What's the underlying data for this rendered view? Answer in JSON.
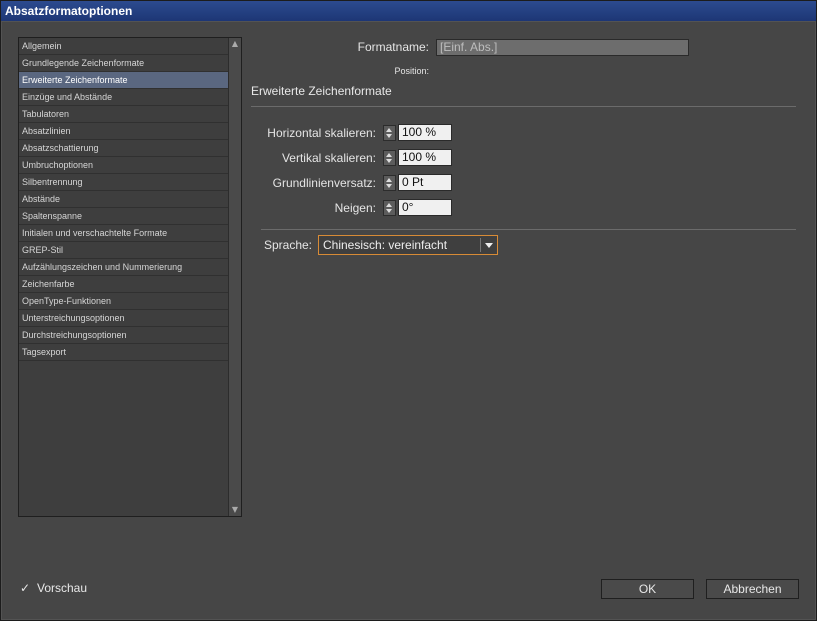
{
  "window": {
    "title": "Absatzformatoptionen"
  },
  "sidebar": {
    "items": [
      {
        "label": "Allgemein"
      },
      {
        "label": "Grundlegende Zeichenformate"
      },
      {
        "label": "Erweiterte Zeichenformate"
      },
      {
        "label": "Einzüge und Abstände"
      },
      {
        "label": "Tabulatoren"
      },
      {
        "label": "Absatzlinien"
      },
      {
        "label": "Absatzschattierung"
      },
      {
        "label": "Umbruchoptionen"
      },
      {
        "label": "Silbentrennung"
      },
      {
        "label": "Abstände"
      },
      {
        "label": "Spaltenspanne"
      },
      {
        "label": "Initialen und verschachtelte Formate"
      },
      {
        "label": "GREP-Stil"
      },
      {
        "label": "Aufzählungszeichen und Nummerierung"
      },
      {
        "label": "Zeichenfarbe"
      },
      {
        "label": "OpenType-Funktionen"
      },
      {
        "label": "Unterstreichungsoptionen"
      },
      {
        "label": "Durchstreichungsoptionen"
      },
      {
        "label": "Tagsexport"
      }
    ],
    "selected_index": 2
  },
  "main": {
    "formatname_label": "Formatname:",
    "formatname_value": "[Einf. Abs.]",
    "position_label": "Position:",
    "section_title": "Erweiterte Zeichenformate",
    "fields": {
      "horizontal_label": "Horizontal skalieren:",
      "horizontal_value": "100 %",
      "vertical_label": "Vertikal skalieren:",
      "vertical_value": "100 %",
      "baseline_label": "Grundlinienversatz:",
      "baseline_value": "0 Pt",
      "skew_label": "Neigen:",
      "skew_value": "0°"
    },
    "language_label": "Sprache:",
    "language_value": "Chinesisch: vereinfacht"
  },
  "footer": {
    "preview_label": "Vorschau",
    "preview_checked": true,
    "ok_label": "OK",
    "cancel_label": "Abbrechen"
  },
  "colors": {
    "titlebar": "#2c4b8f",
    "selection": "#5a6780",
    "focus_accent": "#d88b36"
  }
}
